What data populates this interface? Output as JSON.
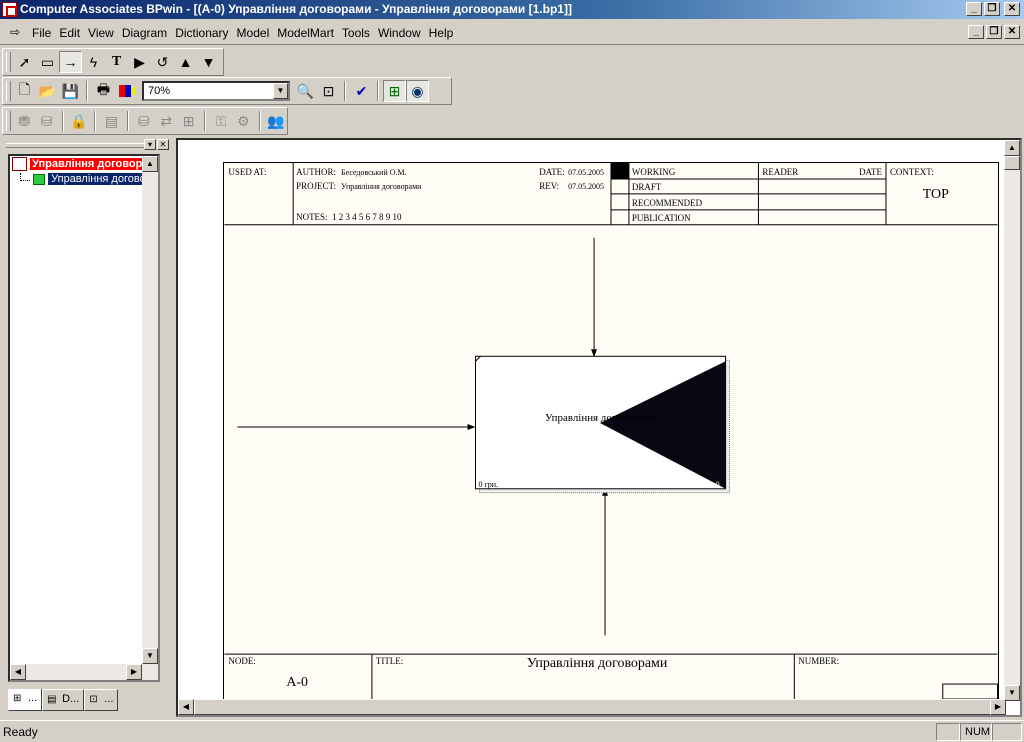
{
  "window": {
    "title": "Computer Associates BPwin - [(A-0) Управління договорами - Управління договорами  [1.bp1]]"
  },
  "menu": [
    "File",
    "Edit",
    "View",
    "Diagram",
    "Dictionary",
    "Model",
    "ModelMart",
    "Tools",
    "Window",
    "Help"
  ],
  "toolbar": {
    "zoom": "70%"
  },
  "tree": {
    "root": "Управління договорами",
    "child": "Управління договорами"
  },
  "tabs": [
    "...",
    "D...",
    "..."
  ],
  "diagram": {
    "header": {
      "used_at": "USED AT:",
      "author_label": "AUTHOR:",
      "author": "Беседовський О.М.",
      "project_label": "PROJECT:",
      "project": "Управління договорами",
      "date_label": "DATE:",
      "date": "07.05.2005",
      "rev_label": "REV:",
      "rev": "07.05.2005",
      "notes_label": "NOTES:",
      "notes": "1  2  3  4  5  6  7  8  9  10",
      "status": [
        "WORKING",
        "DRAFT",
        "RECOMMENDED",
        "PUBLICATION"
      ],
      "reader": "READER",
      "date_col": "DATE",
      "context_label": "CONTEXT:",
      "context": "TOP"
    },
    "activity": {
      "name": "Управління договорами",
      "cost": "0 грн.",
      "number": "0"
    },
    "footer": {
      "node_label": "NODE:",
      "node": "A-0",
      "title_label": "TITLE:",
      "title": "Управління договорами",
      "number_label": "NUMBER:"
    }
  },
  "status": {
    "text": "Ready",
    "num": "NUM"
  }
}
